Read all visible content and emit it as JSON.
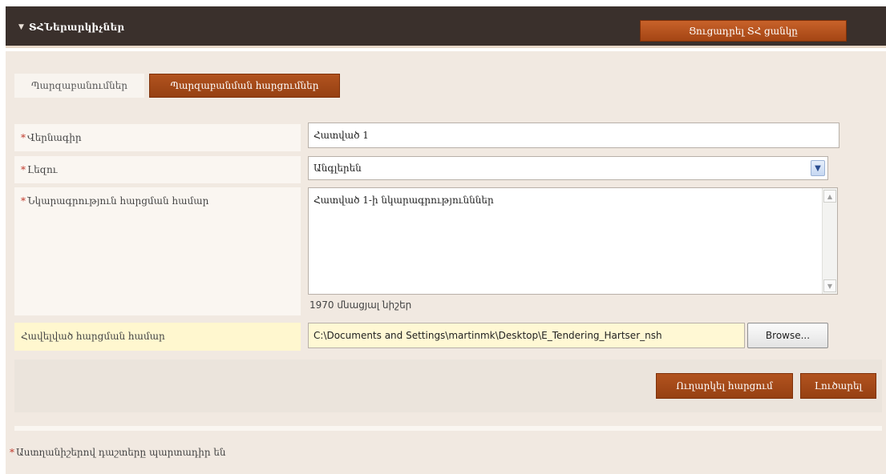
{
  "header": {
    "chevron_icon": "chevron-down-icon",
    "title": "ՏՀՆերարկիչներ",
    "export_button": "Ցուցադրել ՏՀ ցանկը"
  },
  "tabs": [
    {
      "label": "Պարզաբանումներ",
      "active": false
    },
    {
      "label": "Պարզաբանման հարցումներ",
      "active": true
    }
  ],
  "form": {
    "required_marker": "*",
    "title_label": "Վերնագիր",
    "title_value": "Հատված 1",
    "language_label": "Լեզու",
    "language_value": "Անգլերեն",
    "description_label": "Նկարագրություն հարցման համար",
    "description_value": "Հատված 1-ի նկարագրությունններ",
    "char_count": "1970 մնացյալ նիշեր",
    "attachment_label": "Հավելված հարցման համար",
    "attachment_value": "C:\\Documents and Settings\\martinmk\\Desktop\\E_Tendering_Hartser_nsh",
    "browse_label": "Browse..."
  },
  "actions": {
    "submit_label": "Ուղարկել հարցում",
    "cancel_label": "Լուծարել"
  },
  "footnote": "Աստղանիշերով դաշտերը պարտադիր են",
  "colors": {
    "header_bg": "#3a302c",
    "accent": "#a44514",
    "panel_bg": "#f1e9e1",
    "required": "#c0392b",
    "attachment_highlight": "#fff7cf"
  }
}
